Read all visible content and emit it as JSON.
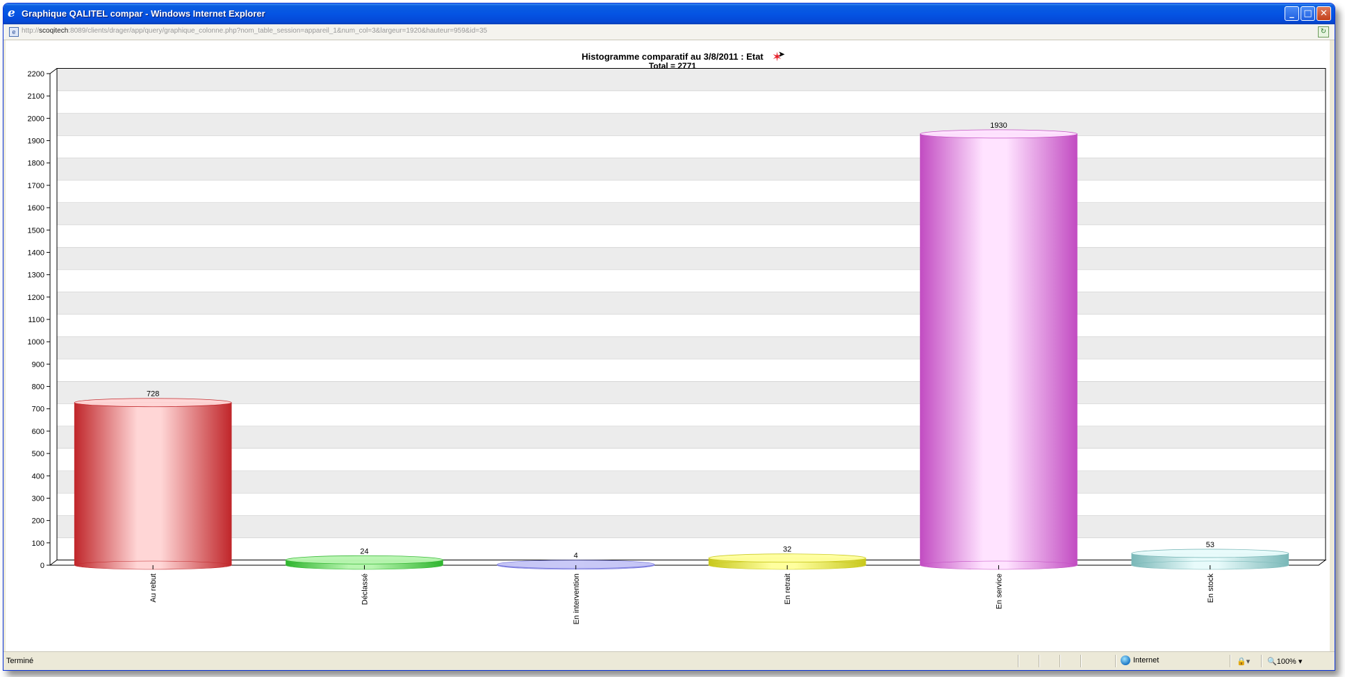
{
  "window": {
    "title": "Graphique QALITEL compar - Windows Internet Explorer",
    "url_host": "scoqitech",
    "url_prefix": "http://",
    "url_rest": ":8089/clients/drager/app/query/graphique_colonne.php?nom_table_session=appareil_1&num_col=3&largeur=1920&hauteur=959&id=35",
    "minimize_glyph": "_",
    "maximize_glyph": "□",
    "close_glyph": "✕"
  },
  "status": {
    "text": "Terminé",
    "zone": "Internet",
    "zoom": "100%",
    "zoom_arrow": "▾",
    "lock_glyph": "🔒▾"
  },
  "icons": [
    "ie-logo-icon",
    "page-icon",
    "go-icon",
    "globe-icon",
    "zoom-icon",
    "cursor-icon",
    "star-icon"
  ],
  "chart_data": {
    "type": "bar",
    "title": "Histogramme comparatif au 3/8/2011 :  Etat",
    "subtitle": "Total = 2771",
    "categories": [
      "Au rebut",
      "Déclassé",
      "En intervention",
      "En retrait",
      "En service",
      "En stock"
    ],
    "values": [
      728,
      24,
      4,
      32,
      1930,
      53
    ],
    "data_labels": [
      "728",
      "24",
      "4",
      "32",
      "1930",
      "53"
    ],
    "colors": [
      [
        "#c0262a",
        "#ffd6d6"
      ],
      [
        "#2fb52f",
        "#b8f5b0"
      ],
      [
        "#7777dd",
        "#c9c9f7"
      ],
      [
        "#c8c81c",
        "#ffff9e"
      ],
      [
        "#c24cc2",
        "#ffe3ff"
      ],
      [
        "#7ab8b8",
        "#e8fbfb"
      ]
    ],
    "ylim": [
      0,
      2200
    ],
    "yticks": [
      0,
      100,
      200,
      300,
      400,
      500,
      600,
      700,
      800,
      900,
      1000,
      1100,
      1200,
      1300,
      1400,
      1500,
      1600,
      1700,
      1800,
      1900,
      2000,
      2100,
      2200
    ],
    "grid": "alternating bands",
    "band_color": "#ececec",
    "xlabel": "",
    "ylabel": ""
  }
}
